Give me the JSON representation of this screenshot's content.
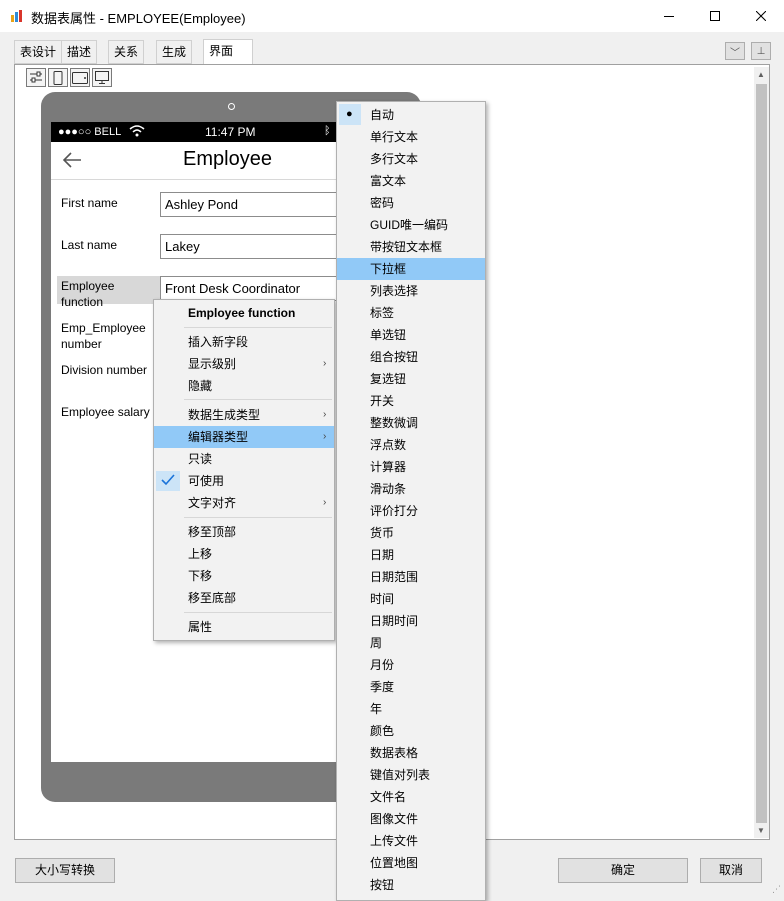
{
  "window": {
    "title": "数据表属性 - EMPLOYEE(Employee)"
  },
  "tabs": [
    "表设计",
    "描述",
    "关系",
    "生成",
    "界面"
  ],
  "phone": {
    "carrier": "●●●○○ BELL",
    "time": "11:47 PM",
    "title": "Employee",
    "fields": [
      {
        "label": "First name",
        "value": "Ashley Pond"
      },
      {
        "label": "Last name",
        "value": "Lakey"
      },
      {
        "label": "Employee function",
        "value": "Front Desk Coordinator"
      },
      {
        "label": "Emp_Employee number"
      },
      {
        "label": "Division number"
      },
      {
        "label": "Employee salary"
      }
    ]
  },
  "context_menu": {
    "header": "Employee function",
    "items": [
      "插入新字段",
      "显示级别",
      "隐藏",
      "数据生成类型",
      "编辑器类型",
      "只读",
      "可使用",
      "文字对齐",
      "移至顶部",
      "上移",
      "下移",
      "移至底部",
      "属性"
    ]
  },
  "submenu": {
    "items": [
      "自动",
      "单行文本",
      "多行文本",
      "富文本",
      "密码",
      "GUID唯一编码",
      "带按钮文本框",
      "下拉框",
      "列表选择",
      "标签",
      "单选钮",
      "组合按钮",
      "复选钮",
      "开关",
      "整数微调",
      "浮点数",
      "计算器",
      "滑动条",
      "评价打分",
      "货币",
      "日期",
      "日期范围",
      "时间",
      "日期时间",
      "周",
      "月份",
      "季度",
      "年",
      "颜色",
      "数据表格",
      "键值对列表",
      "文件名",
      "图像文件",
      "上传文件",
      "位置地图",
      "按钮"
    ]
  },
  "buttons": {
    "case_convert": "大小写转换",
    "ok": "确定",
    "cancel": "取消"
  },
  "colors": {
    "highlight": "#91c9f7",
    "check": "#1a73d9"
  }
}
